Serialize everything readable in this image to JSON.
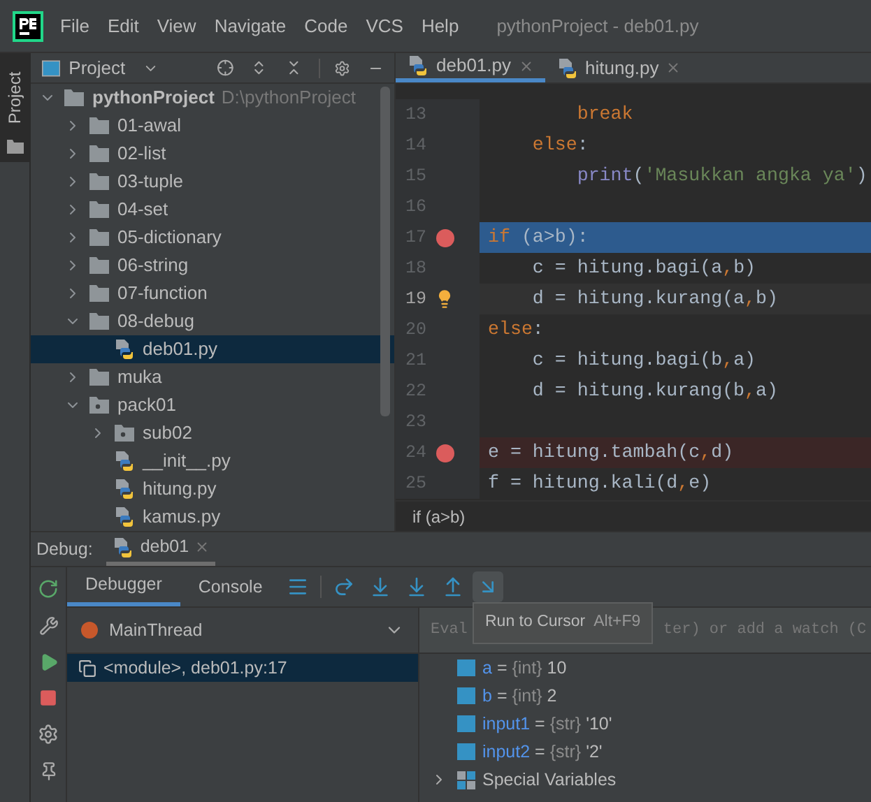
{
  "title_bar": {
    "menu": [
      "File",
      "Edit",
      "View",
      "Navigate",
      "Code",
      "VCS",
      "Help"
    ],
    "title": "pythonProject - deb01.py"
  },
  "side_stripe": {
    "tabs": [
      {
        "label": "Project",
        "selected": true
      }
    ]
  },
  "project_panel": {
    "title": "Project",
    "tree": [
      {
        "label": "pythonProject",
        "path": "D:\\pythonProject",
        "kind": "folder",
        "expanded": true,
        "selected": false,
        "children": [
          {
            "label": "01-awal",
            "kind": "folder",
            "expanded": false,
            "selected": false
          },
          {
            "label": "02-list",
            "kind": "folder",
            "expanded": false,
            "selected": false
          },
          {
            "label": "03-tuple",
            "kind": "folder",
            "expanded": false,
            "selected": false
          },
          {
            "label": "04-set",
            "kind": "folder",
            "expanded": false,
            "selected": false
          },
          {
            "label": "05-dictionary",
            "kind": "folder",
            "expanded": false,
            "selected": false
          },
          {
            "label": "06-string",
            "kind": "folder",
            "expanded": false,
            "selected": false
          },
          {
            "label": "07-function",
            "kind": "folder",
            "expanded": false,
            "selected": false
          },
          {
            "label": "08-debug",
            "kind": "folder",
            "expanded": true,
            "selected": false,
            "children": [
              {
                "label": "deb01.py",
                "kind": "python",
                "selected": true
              }
            ]
          },
          {
            "label": "muka",
            "kind": "folder",
            "expanded": false,
            "selected": false
          },
          {
            "label": "pack01",
            "kind": "package",
            "expanded": true,
            "selected": false,
            "children": [
              {
                "label": "sub02",
                "kind": "package",
                "expanded": false,
                "selected": false
              },
              {
                "label": "__init__.py",
                "kind": "python",
                "selected": false
              },
              {
                "label": "hitung.py",
                "kind": "python",
                "selected": false
              },
              {
                "label": "kamus.py",
                "kind": "python",
                "selected": false
              }
            ]
          }
        ]
      }
    ]
  },
  "editor": {
    "tabs": [
      {
        "label": "deb01.py",
        "selected": true
      },
      {
        "label": "hitung.py",
        "selected": false
      }
    ],
    "lines": [
      {
        "number": "13",
        "breakpoint": false,
        "current": false,
        "caret": false,
        "tokens": [
          {
            "text": "        break",
            "kind": "keyword"
          }
        ]
      },
      {
        "number": "14",
        "breakpoint": false,
        "current": false,
        "caret": false,
        "tokens": [
          {
            "text": "    else",
            "kind": "keyword"
          },
          {
            "text": ":",
            "kind": "plain"
          }
        ]
      },
      {
        "number": "15",
        "breakpoint": false,
        "current": false,
        "caret": false,
        "tokens": [
          {
            "text": "        print",
            "kind": "builtin"
          },
          {
            "text": "(",
            "kind": "plain"
          },
          {
            "text": "'Masukkan angka ya'",
            "kind": "string"
          },
          {
            "text": ")",
            "kind": "plain"
          }
        ]
      },
      {
        "number": "16",
        "breakpoint": false,
        "current": false,
        "caret": false
      },
      {
        "number": "17",
        "breakpoint": true,
        "current": true,
        "caret": false,
        "tokens": [
          {
            "text": "if",
            "kind": "keyword"
          },
          {
            "text": " (a>b):",
            "kind": "plain"
          }
        ]
      },
      {
        "number": "18",
        "breakpoint": false,
        "current": false,
        "caret": false,
        "tokens": [
          {
            "text": "    c = hitung.bagi(a",
            "kind": "plain"
          },
          {
            "text": ",",
            "kind": "keyword"
          },
          {
            "text": "b)",
            "kind": "plain"
          }
        ]
      },
      {
        "number": "19",
        "breakpoint": false,
        "current": false,
        "caret": true,
        "tokens": [
          {
            "text": "    d = hitung.kurang(a",
            "kind": "plain"
          },
          {
            "text": ",",
            "kind": "keyword"
          },
          {
            "text": "b)",
            "kind": "plain"
          }
        ]
      },
      {
        "number": "20",
        "breakpoint": false,
        "current": false,
        "caret": false,
        "tokens": [
          {
            "text": "else",
            "kind": "keyword"
          },
          {
            "text": ":",
            "kind": "plain"
          }
        ]
      },
      {
        "number": "21",
        "breakpoint": false,
        "current": false,
        "caret": false,
        "tokens": [
          {
            "text": "    c = hitung.bagi(b",
            "kind": "plain"
          },
          {
            "text": ",",
            "kind": "keyword"
          },
          {
            "text": "a)",
            "kind": "plain"
          }
        ]
      },
      {
        "number": "22",
        "breakpoint": false,
        "current": false,
        "caret": false,
        "tokens": [
          {
            "text": "    d = hitung.kurang(b",
            "kind": "plain"
          },
          {
            "text": ",",
            "kind": "keyword"
          },
          {
            "text": "a)",
            "kind": "plain"
          }
        ]
      },
      {
        "number": "23",
        "breakpoint": false,
        "current": false,
        "caret": false
      },
      {
        "number": "24",
        "breakpoint": true,
        "current": false,
        "caret": false,
        "tokens": [
          {
            "text": "e = hitung.tambah(c",
            "kind": "plain"
          },
          {
            "text": ",",
            "kind": "keyword"
          },
          {
            "text": "d)",
            "kind": "plain"
          }
        ]
      },
      {
        "number": "25",
        "breakpoint": false,
        "current": false,
        "caret": false,
        "tokens": [
          {
            "text": "f = hitung.kali(d",
            "kind": "plain"
          },
          {
            "text": ",",
            "kind": "keyword"
          },
          {
            "text": "e)",
            "kind": "plain"
          }
        ]
      }
    ],
    "breadcrumb": "if (a>b)"
  },
  "debug": {
    "label": "Debug:",
    "session": "deb01",
    "tabs": [
      {
        "label": "Debugger",
        "selected": true
      },
      {
        "label": "Console",
        "selected": false
      }
    ],
    "thread": "MainThread",
    "frames": [
      {
        "label": "<module>, deb01.py:17",
        "selected": true
      }
    ],
    "evaluate_field": {
      "placeholder_start": "Eval",
      "placeholder_end": "ter) or add a watch (C"
    },
    "tooltip": {
      "text": "Run to Cursor",
      "shortcut": "Alt+F9"
    },
    "variables": [
      {
        "name": "a",
        "separator": "=",
        "type": "{int}",
        "value": "10"
      },
      {
        "name": "b",
        "separator": "=",
        "type": "{int}",
        "value": "2"
      },
      {
        "name": "input1",
        "separator": "=",
        "type": "{str}",
        "value": "'10'"
      },
      {
        "name": "input2",
        "separator": "=",
        "type": "{str}",
        "value": "'2'"
      }
    ],
    "special_variables": {
      "label": "Special Variables",
      "expanded": false
    }
  }
}
